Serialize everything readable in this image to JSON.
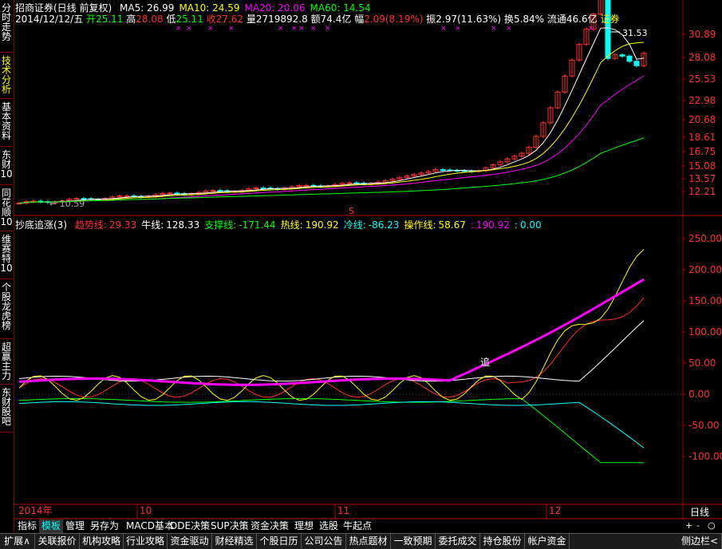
{
  "sidebar": {
    "tabs": [
      {
        "label": "分时走势",
        "name": "sidebar-tab-intraday"
      },
      {
        "label": "技术分析",
        "name": "sidebar-tab-technical",
        "active": true
      },
      {
        "label": "基本资料",
        "name": "sidebar-tab-fundamentals"
      },
      {
        "label": "东财10",
        "name": "sidebar-tab-dongcai10"
      },
      {
        "label": "同花顺10",
        "name": "sidebar-tab-tonghuashun10"
      },
      {
        "label": "维赛特10",
        "name": "sidebar-tab-weisaite10"
      },
      {
        "label": "个股龙虎榜",
        "name": "sidebar-tab-dragon-tiger"
      },
      {
        "label": "超赢主力",
        "name": "sidebar-tab-chaoying"
      },
      {
        "label": "东财股吧",
        "name": "sidebar-tab-guba"
      }
    ]
  },
  "header": {
    "title": "招商证券(日线 前复权)",
    "ma": [
      {
        "label": "MA5: 26.99",
        "color": "#ffffff"
      },
      {
        "label": "MA10: 24.59",
        "color": "#ffff00"
      },
      {
        "label": "MA20: 20.06",
        "color": "#ff00ff"
      },
      {
        "label": "MA60: 14.54",
        "color": "#00ff00"
      }
    ],
    "quote": {
      "date": "2014/12/12/五",
      "open_label": "开",
      "open": "25.11",
      "high_label": "高",
      "high": "28.08",
      "low_label": "低",
      "low": "25.11",
      "close_label": "收",
      "close": "27.62",
      "volume_label": "量",
      "volume": "2719892.8",
      "amount_label": "额",
      "amount": "74.4亿",
      "change_label": "幅",
      "change": "2.09(8.19%)",
      "amplitude_label": "振",
      "amplitude": "2.97(11.63%)",
      "turnover_label": "换",
      "turnover": "5.84%",
      "float_label": "流通",
      "float": "46.6亿",
      "sector": "证券"
    }
  },
  "price_axis": [
    "30.89",
    "28.08",
    "25.53",
    "22.98",
    "20.68",
    "18.61",
    "16.75",
    "15.08",
    "13.57",
    "12.21"
  ],
  "price_annotations": {
    "high": "31.53",
    "low": "10.59"
  },
  "indicator": {
    "name": "抄底追涨(3)",
    "values": [
      {
        "label": "趋势线:",
        "value": "29.33",
        "color": "#ff3030"
      },
      {
        "label": "牛线:",
        "value": "128.33",
        "color": "#ffffff"
      },
      {
        "label": "支撑线:",
        "value": "-171.44",
        "color": "#00ff00"
      },
      {
        "label": "热线:",
        "value": "190.92",
        "color": "#ffff00"
      },
      {
        "label": "冷线:",
        "value": "-86.23",
        "color": "#00ffff"
      },
      {
        "label": "操作线:",
        "value": "58.67",
        "color": "#ffff00"
      },
      {
        "label": ":",
        "value": "190.92",
        "color": "#ff00ff"
      },
      {
        "label": ":",
        "value": "0.00",
        "color": "#00ffff"
      }
    ],
    "axis": [
      "250.00",
      "200.00",
      "150.00",
      "100.00",
      "50.00",
      "0.00",
      "-50.00",
      "-100.00"
    ],
    "marker": "追"
  },
  "x_axis": {
    "year": "2014年",
    "months": [
      "10",
      "11",
      "12"
    ],
    "period": "日线"
  },
  "zoom": {
    "plus": "+",
    "minus": "-",
    "dot": "○"
  },
  "toolbar": [
    {
      "label": "指标",
      "name": "toolbar-indicator"
    },
    {
      "label": "模板",
      "name": "toolbar-template",
      "active": true
    },
    {
      "label": "管理",
      "name": "toolbar-manage"
    },
    {
      "label": "另存为",
      "name": "toolbar-save-as"
    },
    {
      "label": "MACD基本",
      "name": "toolbar-macd"
    },
    {
      "label": "DDE决策",
      "name": "toolbar-dde"
    },
    {
      "label": "SUP决策",
      "name": "toolbar-sup"
    },
    {
      "label": "资金决策",
      "name": "toolbar-fund-decision"
    },
    {
      "label": "理想",
      "name": "toolbar-ideal"
    },
    {
      "label": "选股",
      "name": "toolbar-stock-pick"
    },
    {
      "label": "牛起点",
      "name": "toolbar-bull-start"
    }
  ],
  "bottom_bar": [
    {
      "label": "扩展∧",
      "name": "bottom-expand"
    },
    {
      "label": "关联报价",
      "name": "bottom-related-quote"
    },
    {
      "label": "机构攻略",
      "name": "bottom-institution"
    },
    {
      "label": "行业攻略",
      "name": "bottom-industry"
    },
    {
      "label": "资金驱动",
      "name": "bottom-fund-drive"
    },
    {
      "label": "财经精选",
      "name": "bottom-finance"
    },
    {
      "label": "个股日历",
      "name": "bottom-calendar"
    },
    {
      "label": "公司公告",
      "name": "bottom-announcements"
    },
    {
      "label": "热点题材",
      "name": "bottom-hot-topics"
    },
    {
      "label": "一致预期",
      "name": "bottom-consensus"
    },
    {
      "label": "委托成交",
      "name": "bottom-orders"
    },
    {
      "label": "持仓股份",
      "name": "bottom-holdings"
    },
    {
      "label": "帐户资金",
      "name": "bottom-account"
    },
    {
      "label": "侧边栏<",
      "name": "bottom-sidebar-toggle"
    }
  ],
  "chart_data": [
    {
      "type": "candlestick",
      "title": "招商证券(日线 前复权)",
      "x": "2014-09 to 2014-12-12 (daily)",
      "close_points": [
        {
          "date": "2014-12-12",
          "open": 25.11,
          "high": 28.08,
          "low": 25.11,
          "close": 27.62
        },
        {
          "date": "2014-12-05",
          "close": 28.08
        },
        {
          "date": "2014-12-01",
          "close": 20.5
        },
        {
          "date": "2014-11-25",
          "close": 17.5
        },
        {
          "date": "2014-11-20",
          "close": 15.1
        },
        {
          "date": "2014-11-10",
          "close": 13.9
        },
        {
          "date": "2014-10-20",
          "close": 12.4
        },
        {
          "date": "2014-10-01",
          "close": 11.9
        },
        {
          "date": "2014-09-01",
          "close": 11.4
        }
      ],
      "series": [
        {
          "name": "MA5",
          "last": 26.99,
          "color": "#ffffff"
        },
        {
          "name": "MA10",
          "last": 24.59,
          "color": "#ffff00"
        },
        {
          "name": "MA20",
          "last": 20.06,
          "color": "#ff00ff"
        },
        {
          "name": "MA60",
          "last": 14.54,
          "color": "#00ff00"
        }
      ],
      "ylim": [
        10.59,
        31.53
      ]
    },
    {
      "type": "line",
      "title": "抄底追涨(3)",
      "series": [
        {
          "name": "趋势线",
          "last": 29.33
        },
        {
          "name": "牛线",
          "last": 128.33
        },
        {
          "name": "支撑线",
          "last": -171.44
        },
        {
          "name": "热线",
          "last": 190.92
        },
        {
          "name": "冷线",
          "last": -86.23
        },
        {
          "name": "操作线",
          "last": 58.67
        }
      ],
      "ylim": [
        -100,
        250
      ]
    }
  ]
}
